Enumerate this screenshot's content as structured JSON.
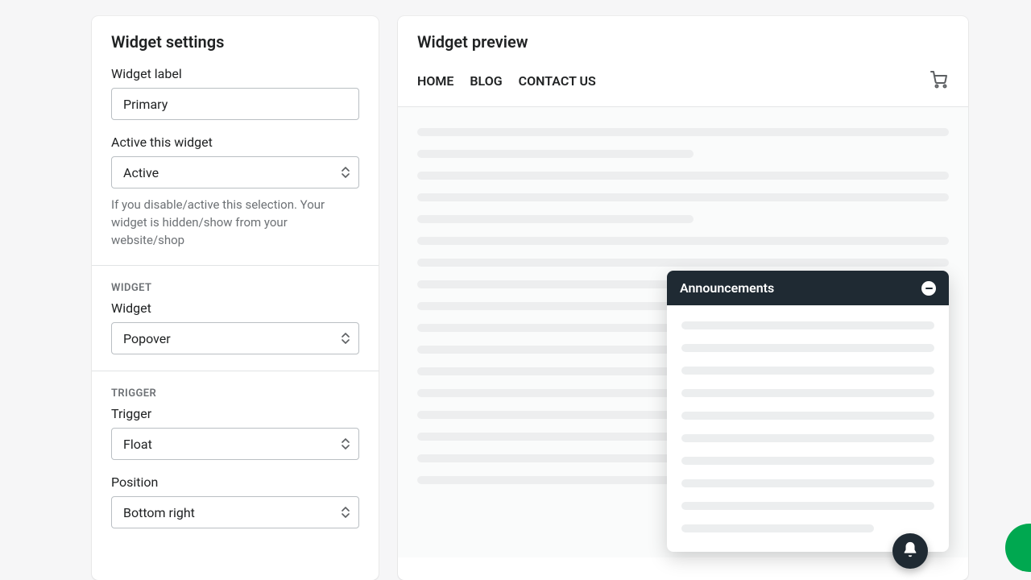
{
  "settings": {
    "title": "Widget settings",
    "widget_label": {
      "label": "Widget label",
      "value": "Primary"
    },
    "active": {
      "label": "Active this widget",
      "value": "Active",
      "help": "If you disable/active this selection. Your widget is hidden/show from your website/shop"
    },
    "widget_section": {
      "heading": "WIDGET",
      "label": "Widget",
      "value": "Popover"
    },
    "trigger_section": {
      "heading": "TRIGGER",
      "label": "Trigger",
      "value": "Float",
      "position_label": "Position",
      "position_value": "Bottom right"
    }
  },
  "preview": {
    "title": "Widget preview",
    "nav": [
      "HOME",
      "BLOG",
      "CONTACT US"
    ],
    "popover_title": "Announcements"
  }
}
